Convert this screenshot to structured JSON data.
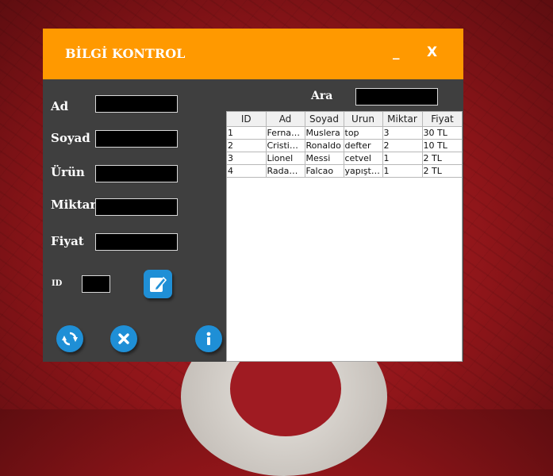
{
  "window": {
    "title": "BİLGİ KONTROL",
    "minimize_label": "_",
    "close_label": "X"
  },
  "form": {
    "ad_label": "Ad",
    "soyad_label": "Soyad",
    "urun_label": "Ürün",
    "miktar_label": "Miktar",
    "fiyat_label": "Fiyat",
    "id_label": "ID",
    "ad_value": "",
    "soyad_value": "",
    "urun_value": "",
    "miktar_value": "",
    "fiyat_value": "",
    "id_value": ""
  },
  "search": {
    "label": "Ara",
    "value": ""
  },
  "table": {
    "headers": [
      "ID",
      "Ad",
      "Soyad",
      "Urun",
      "Miktar",
      "Fiyat"
    ],
    "rows": [
      [
        "1",
        "Fernando",
        "Muslera",
        "top",
        "3",
        "30 TL"
      ],
      [
        "2",
        "Cristiano",
        "Ronaldo",
        "defter",
        "2",
        "10 TL"
      ],
      [
        "3",
        "Lionel",
        "Messi",
        "cetvel",
        "1",
        "2 TL"
      ],
      [
        "4",
        "Radamel",
        "Falcao",
        "yapıştırıcı",
        "1",
        "2 TL"
      ]
    ]
  },
  "icons": {
    "edit": "edit-icon",
    "refresh": "refresh-icon",
    "delete": "delete-icon",
    "info": "info-icon"
  },
  "colors": {
    "titlebar": "#ff9900",
    "panel": "#3f3f3f",
    "icon_blue": "#1f8fd6"
  }
}
